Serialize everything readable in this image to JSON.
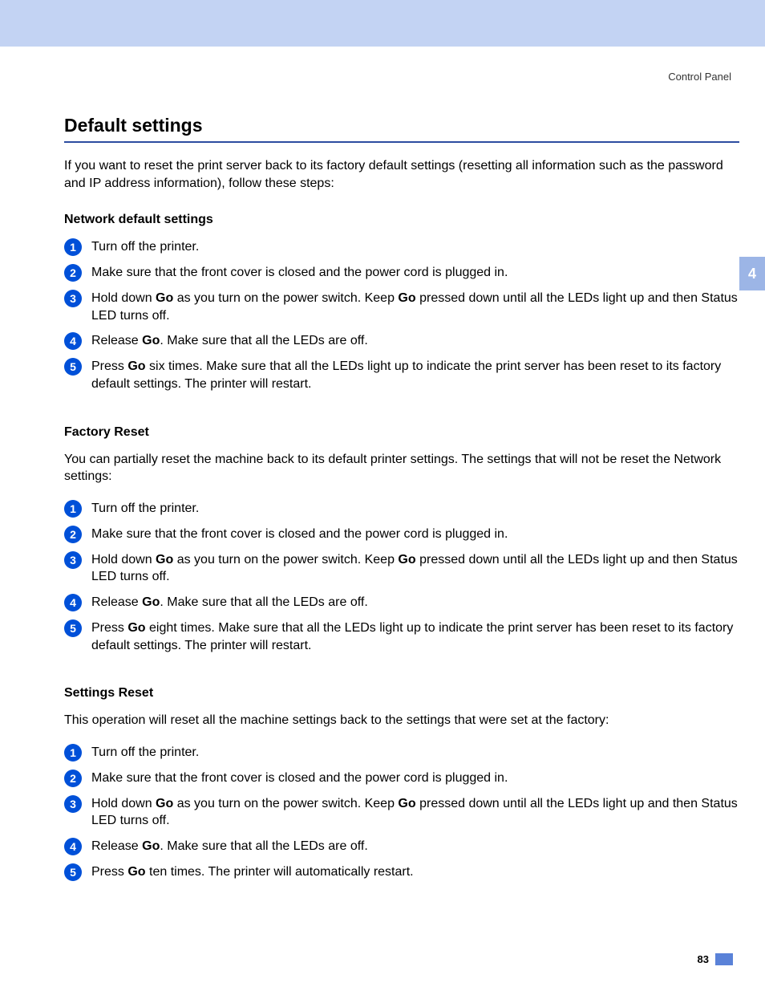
{
  "breadcrumb": "Control Panel",
  "side_tab": "4",
  "page_number": "83",
  "title": "Default settings",
  "intro": "If you want to reset the print server back to its factory default settings (resetting all information such as the password and IP address information), follow these steps:",
  "sections": [
    {
      "heading": "Network default settings",
      "desc": "",
      "steps": [
        [
          {
            "t": "Turn off the printer."
          }
        ],
        [
          {
            "t": "Make sure that the front cover is closed and the power cord is plugged in."
          }
        ],
        [
          {
            "t": "Hold down "
          },
          {
            "t": "Go",
            "b": true
          },
          {
            "t": " as you turn on the power switch. Keep "
          },
          {
            "t": "Go",
            "b": true
          },
          {
            "t": " pressed down until all the LEDs light up and then Status LED turns off."
          }
        ],
        [
          {
            "t": "Release "
          },
          {
            "t": "Go",
            "b": true
          },
          {
            "t": ". Make sure that all the LEDs are off."
          }
        ],
        [
          {
            "t": "Press "
          },
          {
            "t": "Go",
            "b": true
          },
          {
            "t": " six times. Make sure that all the LEDs light up to indicate the print server has been reset to its factory default settings. The printer will restart."
          }
        ]
      ]
    },
    {
      "heading": "Factory Reset",
      "desc": "You can partially reset the machine back to its default printer settings. The settings that will not be reset the Network settings:",
      "steps": [
        [
          {
            "t": "Turn off the printer."
          }
        ],
        [
          {
            "t": "Make sure that the front cover is closed and the power cord is plugged in."
          }
        ],
        [
          {
            "t": "Hold down "
          },
          {
            "t": "Go",
            "b": true
          },
          {
            "t": " as you turn on the power switch. Keep "
          },
          {
            "t": "Go",
            "b": true
          },
          {
            "t": " pressed down until all the LEDs light up and then Status LED turns off."
          }
        ],
        [
          {
            "t": "Release "
          },
          {
            "t": "Go",
            "b": true
          },
          {
            "t": ". Make sure that all the LEDs are off."
          }
        ],
        [
          {
            "t": "Press "
          },
          {
            "t": "Go",
            "b": true
          },
          {
            "t": " eight times. Make sure that all the LEDs light up to indicate the print server has been reset to its factory default settings. The printer will restart."
          }
        ]
      ]
    },
    {
      "heading": "Settings Reset",
      "desc": "This operation will reset all the machine settings back to the settings that were set at the factory:",
      "steps": [
        [
          {
            "t": "Turn off the printer."
          }
        ],
        [
          {
            "t": "Make sure that the front cover is closed and the power cord is plugged in."
          }
        ],
        [
          {
            "t": "Hold down "
          },
          {
            "t": "Go",
            "b": true
          },
          {
            "t": " as you turn on the power switch. Keep "
          },
          {
            "t": "Go",
            "b": true
          },
          {
            "t": " pressed down until all the LEDs light up and then Status LED turns off."
          }
        ],
        [
          {
            "t": "Release "
          },
          {
            "t": "Go",
            "b": true
          },
          {
            "t": ". Make sure that all the LEDs are off."
          }
        ],
        [
          {
            "t": "Press "
          },
          {
            "t": "Go",
            "b": true
          },
          {
            "t": " ten times. The printer will automatically restart."
          }
        ]
      ]
    }
  ]
}
